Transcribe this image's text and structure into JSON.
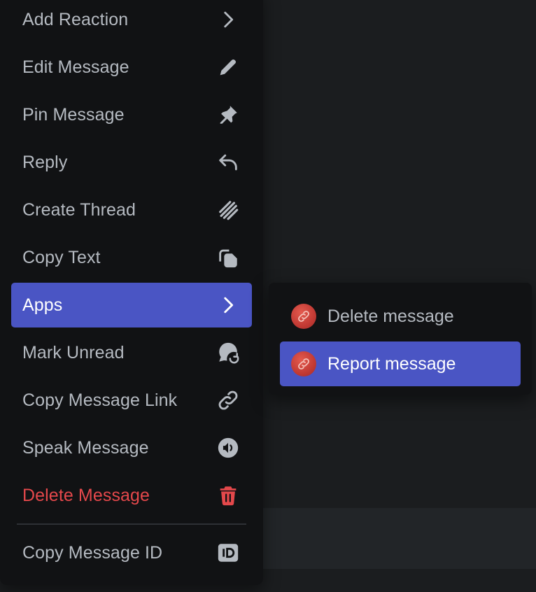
{
  "context_menu": {
    "items": [
      {
        "label": "Add Reaction",
        "icon": "chevron-right-icon"
      },
      {
        "label": "Edit Message",
        "icon": "pencil-icon"
      },
      {
        "label": "Pin Message",
        "icon": "pin-icon"
      },
      {
        "label": "Reply",
        "icon": "reply-arrow-icon"
      },
      {
        "label": "Create Thread",
        "icon": "thread-icon"
      },
      {
        "label": "Copy Text",
        "icon": "copy-icon"
      },
      {
        "label": "Apps",
        "icon": "chevron-right-icon",
        "active": true
      },
      {
        "label": "Mark Unread",
        "icon": "mark-unread-icon"
      },
      {
        "label": "Copy Message Link",
        "icon": "link-icon"
      },
      {
        "label": "Speak Message",
        "icon": "speaker-icon"
      },
      {
        "label": "Delete Message",
        "icon": "trash-icon",
        "danger": true
      },
      {
        "label": "Copy Message ID",
        "icon": "id-badge-icon"
      }
    ]
  },
  "apps_submenu": {
    "items": [
      {
        "label": "Delete message",
        "icon": "app-link-icon"
      },
      {
        "label": "Report message",
        "icon": "app-link-icon",
        "active": true
      }
    ]
  },
  "colors": {
    "accent": "#4a55c4",
    "danger": "#e4484b",
    "menu_bg": "#111214",
    "text": "#b5bac1"
  }
}
